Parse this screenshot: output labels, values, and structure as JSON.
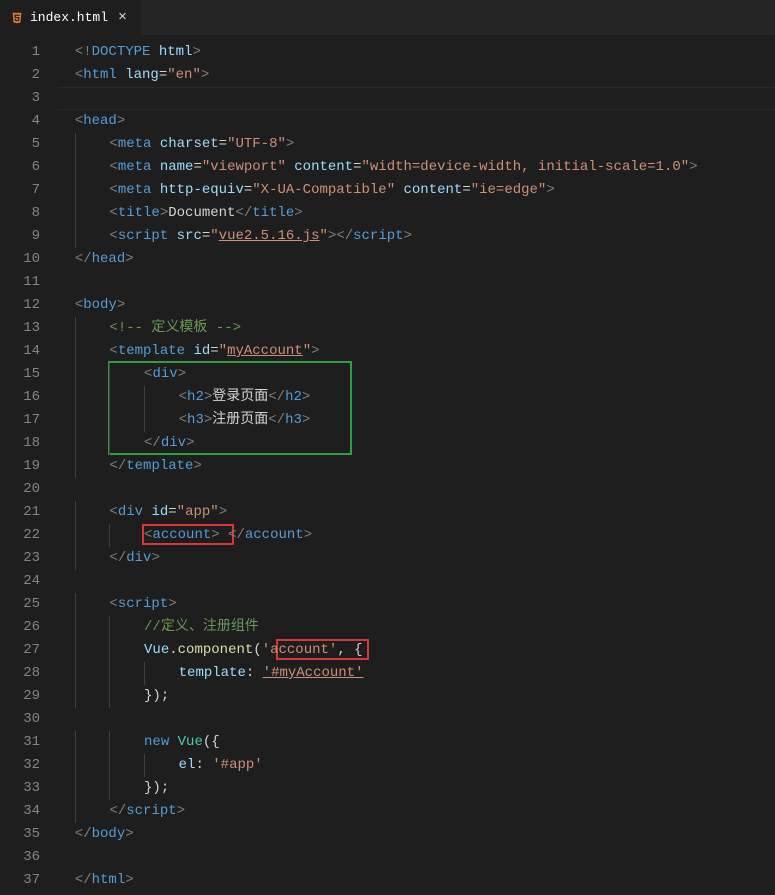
{
  "tab": {
    "filename": "index.html",
    "close": "×"
  },
  "lineCount": 37,
  "code": {
    "l1": {
      "open": "<!",
      "tag": "DOCTYPE",
      "attr": " html",
      "close": ">"
    },
    "l2": {
      "open": "<",
      "tag": "html",
      "attr": " lang",
      "eq": "=",
      "val": "\"en\"",
      "close": ">"
    },
    "l4": {
      "open": "<",
      "tag": "head",
      "close": ">"
    },
    "l5": {
      "open": "<",
      "tag": "meta",
      "attr": " charset",
      "eq": "=",
      "val": "\"UTF-8\"",
      "close": ">"
    },
    "l6": {
      "open": "<",
      "tag": "meta",
      "attr1": " name",
      "val1": "\"viewport\"",
      "attr2": " content",
      "val2": "\"width=device-width, initial-scale=1.0\"",
      "close": ">"
    },
    "l7": {
      "open": "<",
      "tag": "meta",
      "attr1": " http-equiv",
      "val1": "\"X-UA-Compatible\"",
      "attr2": " content",
      "val2": "\"ie=edge\"",
      "close": ">"
    },
    "l8": {
      "open": "<",
      "tag": "title",
      "close": ">",
      "text": "Document",
      "open2": "</",
      "close2": ">"
    },
    "l9": {
      "open": "<",
      "tag": "script",
      "attr": " src",
      "eq": "=",
      "val": "\"",
      "link": "vue2.5.16.js",
      "valend": "\"",
      "close": ">",
      "open2": "</",
      "close2": ">"
    },
    "l10": {
      "open": "</",
      "tag": "head",
      "close": ">"
    },
    "l12": {
      "open": "<",
      "tag": "body",
      "close": ">"
    },
    "l13": {
      "comment": "<!-- 定义模板 -->"
    },
    "l14": {
      "open": "<",
      "tag": "template",
      "attr": " id",
      "eq": "=",
      "val": "\"",
      "link": "myAccount",
      "valend": "\"",
      "close": ">"
    },
    "l15": {
      "open": "<",
      "tag": "div",
      "close": ">"
    },
    "l16": {
      "open": "<",
      "tag": "h2",
      "close": ">",
      "text": "登录页面",
      "open2": "</",
      "close2": ">"
    },
    "l17": {
      "open": "<",
      "tag": "h3",
      "close": ">",
      "text": "注册页面",
      "open2": "</",
      "close2": ">"
    },
    "l18": {
      "open": "</",
      "tag": "div",
      "close": ">"
    },
    "l19": {
      "open": "</",
      "tag": "template",
      "close": ">"
    },
    "l21": {
      "open": "<",
      "tag": "div",
      "attr": " id",
      "eq": "=",
      "val": "\"app\"",
      "close": ">"
    },
    "l22": {
      "open": "<",
      "tag": "account",
      "close": ">",
      "sp": " ",
      "open2": "</",
      "close2": ">"
    },
    "l23": {
      "open": "</",
      "tag": "div",
      "close": ">"
    },
    "l25": {
      "open": "<",
      "tag": "script",
      "close": ">"
    },
    "l26": {
      "comment": "//定义、注册组件"
    },
    "l27": {
      "ident": "Vue",
      "dot": ".",
      "func": "component",
      "p1": "(",
      "str": "'account'",
      "comma": ",",
      "sp": " {"
    },
    "l28": {
      "key": "template",
      "colon": ":",
      "sp": " ",
      "str": "'#myAccount'"
    },
    "l29": {
      "close": "});"
    },
    "l31": {
      "kw": "new",
      "sp": " ",
      "type": "Vue",
      "p": "({"
    },
    "l32": {
      "key": "el",
      "colon": ":",
      "sp": " ",
      "str": "'#app'"
    },
    "l33": {
      "close": "});"
    },
    "l34": {
      "open": "</",
      "tag": "script",
      "close": ">"
    },
    "l35": {
      "open": "</",
      "tag": "body",
      "close": ">"
    },
    "l37": {
      "open": "</",
      "tag": "html",
      "close": ">"
    }
  }
}
